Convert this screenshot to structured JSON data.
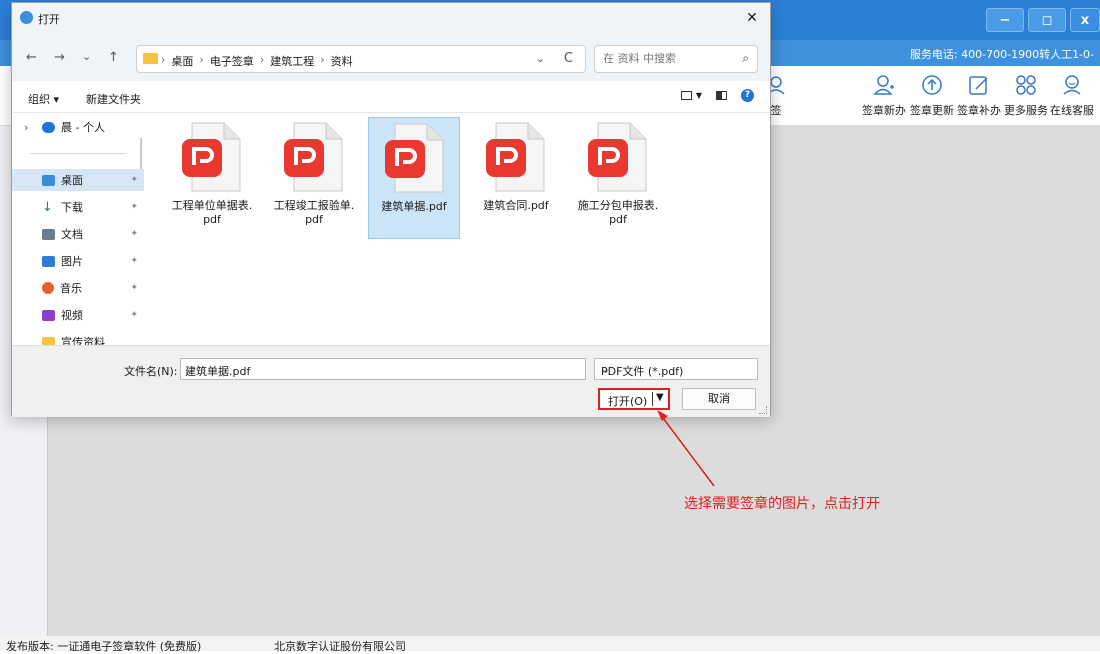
{
  "app": {
    "winbtns": {
      "min": "−",
      "restore": "◻",
      "close": "x"
    },
    "hotline": "服务电话: 400-700-1900转人工1-0-",
    "tools": [
      {
        "label": "签章新办",
        "icon": "person-add-icon"
      },
      {
        "label": "签章更新",
        "icon": "upload-circle-icon"
      },
      {
        "label": "签章补办",
        "icon": "edit-icon"
      },
      {
        "label": "更多服务",
        "icon": "grid-icon"
      },
      {
        "label": "在线客服",
        "icon": "support-icon"
      }
    ],
    "partial_tool": "签",
    "status": {
      "version": "发布版本: 一证通电子签章软件 (免费版)",
      "company": "北京数字认证股份有限公司"
    }
  },
  "dialog": {
    "title": "打开",
    "close": "✕",
    "nav": {
      "back": "←",
      "forward": "→",
      "recent": "⌄",
      "up": "↑"
    },
    "breadcrumbs": [
      "桌面",
      "电子签章",
      "建筑工程",
      "资料"
    ],
    "refresh": "C",
    "search_placeholder": "在 资料 中搜索",
    "organize_label": "组织 ▾",
    "new_folder_label": "新建文件夹",
    "sidebar": [
      {
        "label": "晨 - 个人",
        "color": "#1f74d6"
      },
      {
        "label": "桌面",
        "color": "#3d8bd9",
        "pinned": true
      },
      {
        "label": "下载",
        "color": "#2a8a3e",
        "pinned": true
      },
      {
        "label": "文档",
        "color": "#6b7b8c",
        "pinned": true
      },
      {
        "label": "图片",
        "color": "#2f7bd6",
        "pinned": true
      },
      {
        "label": "音乐",
        "color": "#e5622d",
        "pinned": true
      },
      {
        "label": "视频",
        "color": "#8a3ec9",
        "pinned": true
      },
      {
        "label": "宣传资料",
        "color": "#f6c343"
      }
    ],
    "files": [
      {
        "line1": "工程单位单据表.",
        "line2": "pdf"
      },
      {
        "line1": "工程竣工报验单.",
        "line2": "pdf"
      },
      {
        "line1": "建筑单据.pdf",
        "line2": ""
      },
      {
        "line1": "建筑合同.pdf",
        "line2": ""
      },
      {
        "line1": "施工分包申报表.",
        "line2": "pdf"
      }
    ],
    "filename_label": "文件名(N):",
    "filename_value": "建筑单据.pdf",
    "filetype_value": "PDF文件 (*.pdf)",
    "open_label": "打开(O)",
    "cancel_label": "取消"
  },
  "annotation": "选择需要签章的图片，点击打开",
  "colors": {
    "accent_red": "#e02020",
    "pdf_red": "#e8382f",
    "title_blue": "#2c7fd6"
  }
}
